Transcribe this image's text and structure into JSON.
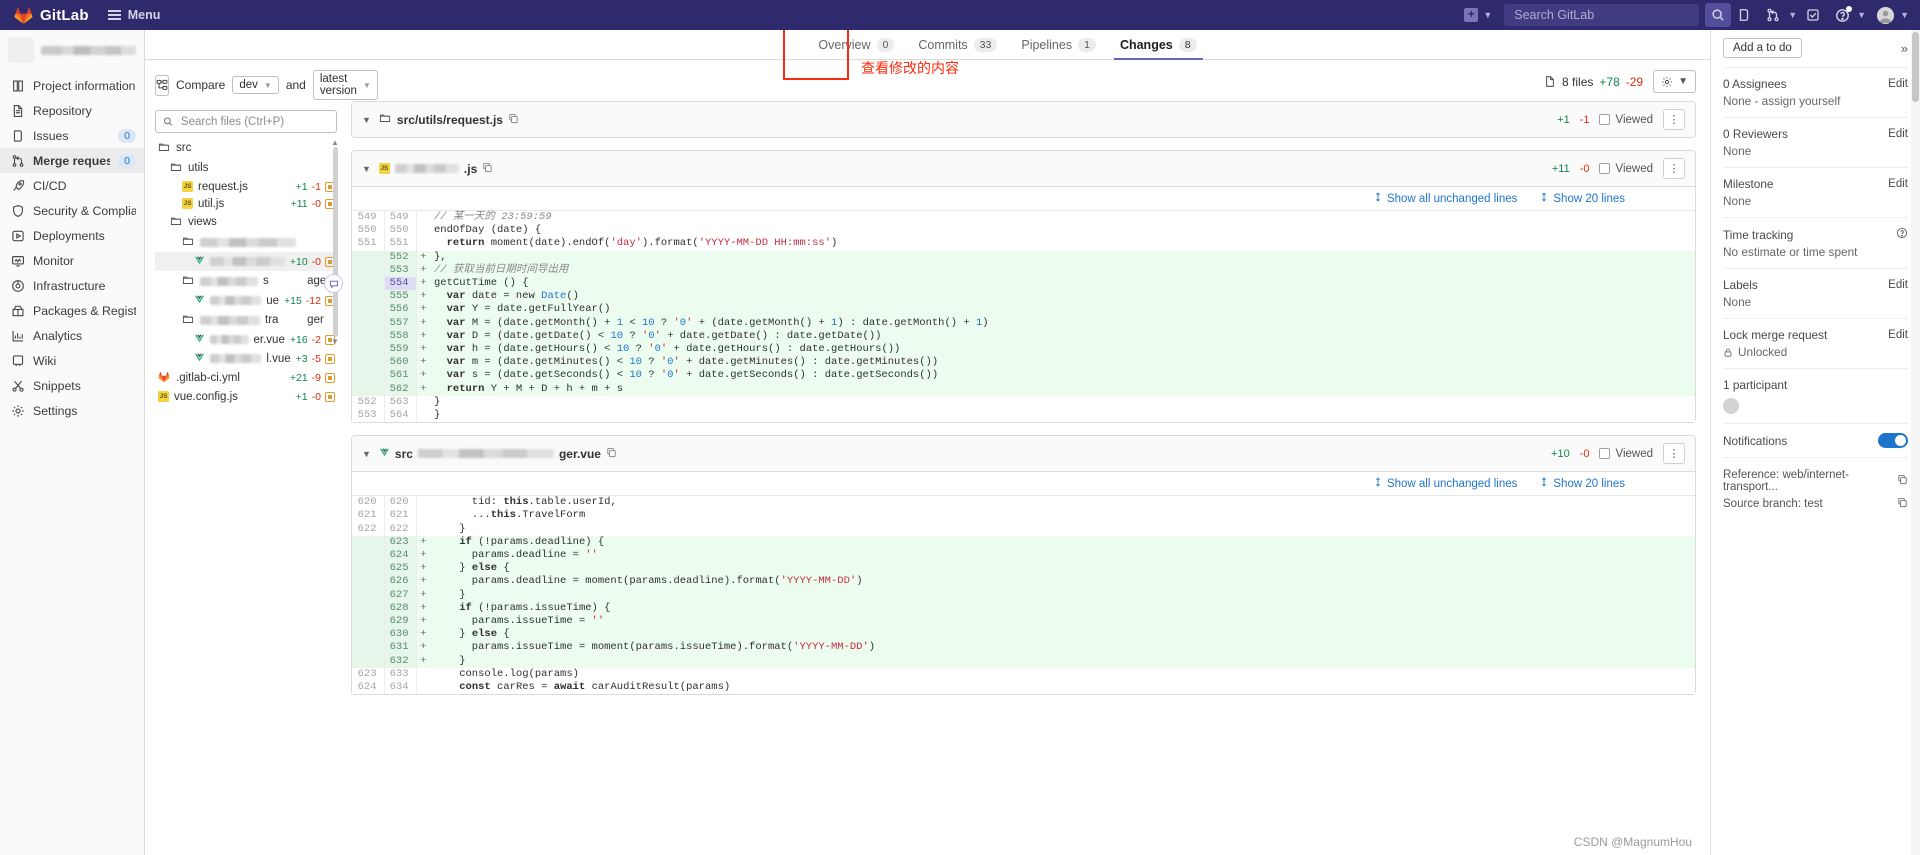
{
  "topnav": {
    "brand": "GitLab",
    "menu_label": "Menu",
    "search_placeholder": "Search GitLab",
    "search_value": "",
    "icons": {
      "plus": "plus-square-icon",
      "caret": "chevron-down-icon",
      "search": "search-icon",
      "issues": "issues-icon",
      "merge_requests": "merge-request-icon",
      "todos": "todo-checkbox-icon",
      "help": "help-circle-icon",
      "avatar": "user-avatar"
    }
  },
  "sidebar": {
    "project_name": "",
    "items": [
      {
        "label": "Project information",
        "icon": "book-icon",
        "badge": ""
      },
      {
        "label": "Repository",
        "icon": "file-icon",
        "badge": ""
      },
      {
        "label": "Issues",
        "icon": "issues-icon",
        "badge": "0"
      },
      {
        "label": "Merge requests",
        "icon": "merge-request-icon",
        "badge": "0"
      },
      {
        "label": "CI/CD",
        "icon": "rocket-icon",
        "badge": ""
      },
      {
        "label": "Security & Compliance",
        "icon": "shield-icon",
        "badge": ""
      },
      {
        "label": "Deployments",
        "icon": "deploy-icon",
        "badge": ""
      },
      {
        "label": "Monitor",
        "icon": "monitor-icon",
        "badge": ""
      },
      {
        "label": "Infrastructure",
        "icon": "infrastructure-icon",
        "badge": ""
      },
      {
        "label": "Packages & Registries",
        "icon": "package-icon",
        "badge": ""
      },
      {
        "label": "Analytics",
        "icon": "chart-icon",
        "badge": ""
      },
      {
        "label": "Wiki",
        "icon": "wiki-icon",
        "badge": ""
      },
      {
        "label": "Snippets",
        "icon": "scissors-icon",
        "badge": ""
      },
      {
        "label": "Settings",
        "icon": "gear-icon",
        "badge": ""
      }
    ],
    "active_index": 3
  },
  "tabs": [
    {
      "label": "Overview",
      "count": "0",
      "active": false
    },
    {
      "label": "Commits",
      "count": "33",
      "active": false
    },
    {
      "label": "Pipelines",
      "count": "1",
      "active": false
    },
    {
      "label": "Changes",
      "count": "8",
      "active": true
    }
  ],
  "annotation": {
    "text": "查看修改的内容",
    "color": "#fb2b0d"
  },
  "compare": {
    "label": "Compare",
    "source": "dev",
    "target": "latest version",
    "tree_icon": "file-tree-icon"
  },
  "file_search": {
    "placeholder": "Search files (Ctrl+P)",
    "value": ""
  },
  "file_tree": [
    {
      "depth": 0,
      "type": "folder",
      "name": "src",
      "blurred": false,
      "stats": null
    },
    {
      "depth": 1,
      "type": "folder",
      "name": "utils",
      "blurred": false,
      "stats": null
    },
    {
      "depth": 2,
      "type": "js",
      "name": "request.js",
      "blurred": false,
      "stats": {
        "add": "+1",
        "del": "-1"
      }
    },
    {
      "depth": 2,
      "type": "js",
      "name": "util.js",
      "blurred": false,
      "stats": {
        "add": "+11",
        "del": "-0"
      }
    },
    {
      "depth": 1,
      "type": "folder",
      "name": "views",
      "blurred": false,
      "stats": null
    },
    {
      "depth": 2,
      "type": "folder",
      "name": "",
      "blurred": true,
      "blur_width": 96,
      "stats": null
    },
    {
      "depth": 3,
      "type": "vue",
      "name": "",
      "blurred": true,
      "blur_width": 92,
      "selected": true,
      "stats": {
        "add": "+10",
        "del": "-0"
      }
    },
    {
      "depth": 2,
      "type": "folder",
      "name": "s            age",
      "blurred": "partial",
      "blur_width": 58,
      "stats": null
    },
    {
      "depth": 3,
      "type": "vue",
      "name": "ue",
      "blurred": "partial",
      "blur_width": 98,
      "stats": {
        "add": "+15",
        "del": "-12"
      }
    },
    {
      "depth": 2,
      "type": "folder",
      "name": "tra         ger",
      "blurred": "partial",
      "blur_width": 60,
      "stats": null
    },
    {
      "depth": 3,
      "type": "vue",
      "name": "er.vue",
      "blurred": "partial",
      "blur_width": 86,
      "stats": {
        "add": "+16",
        "del": "-2"
      }
    },
    {
      "depth": 3,
      "type": "vue",
      "name": "l.vue",
      "blurred": "partial",
      "blur_width": 72,
      "stats": {
        "add": "+3",
        "del": "-5"
      }
    },
    {
      "depth": 0,
      "type": "gitlab",
      "name": ".gitlab-ci.yml",
      "blurred": false,
      "stats": {
        "add": "+21",
        "del": "-9"
      }
    },
    {
      "depth": 0,
      "type": "js",
      "name": "vue.config.js",
      "blurred": false,
      "stats": {
        "add": "+1",
        "del": "-0"
      }
    }
  ],
  "diff_summary": {
    "files_label": "8 files",
    "additions": "+78",
    "deletions": "-29",
    "gear_icon": "gear-icon"
  },
  "diff_files": [
    {
      "path": "src/utils/request.js",
      "blurred": false,
      "additions": "+1",
      "deletions": "-1",
      "viewed_label": "Viewed",
      "collapsed": true,
      "hunks": []
    },
    {
      "path": ".js",
      "blurred": true,
      "blur_width": 64,
      "additions": "+11",
      "deletions": "-0",
      "viewed_label": "Viewed",
      "collapsed": false,
      "expand_links": [
        {
          "label": "Show all unchanged lines",
          "icon": "expand-icon"
        },
        {
          "label": "Show 20 lines",
          "icon": "expand-icon"
        }
      ],
      "lines": [
        {
          "old": "549",
          "new": "549",
          "sign": "",
          "type": "ctx",
          "code": "// 某一天的 23:59:59",
          "style": "comment"
        },
        {
          "old": "550",
          "new": "550",
          "sign": "",
          "type": "ctx",
          "code": "endOfDay (date) {"
        },
        {
          "old": "551",
          "new": "551",
          "sign": "",
          "type": "ctx",
          "code": "  return moment(date).endOf('day').format('YYYY-MM-DD HH:mm:ss')"
        },
        {
          "old": "",
          "new": "552",
          "sign": "+",
          "type": "add",
          "code": "},"
        },
        {
          "old": "",
          "new": "553",
          "sign": "+",
          "type": "add",
          "code": "// 获取当前日期时间导出用",
          "style": "comment"
        },
        {
          "old": "",
          "new": "554",
          "sign": "+",
          "type": "add",
          "code": "getCutTime () {",
          "highlight": true
        },
        {
          "old": "",
          "new": "555",
          "sign": "+",
          "type": "add",
          "code": "  var date = new Date()"
        },
        {
          "old": "",
          "new": "556",
          "sign": "+",
          "type": "add",
          "code": "  var Y = date.getFullYear()"
        },
        {
          "old": "",
          "new": "557",
          "sign": "+",
          "type": "add",
          "code": "  var M = (date.getMonth() + 1 < 10 ? '0' + (date.getMonth() + 1) : date.getMonth() + 1)"
        },
        {
          "old": "",
          "new": "558",
          "sign": "+",
          "type": "add",
          "code": "  var D = (date.getDate() < 10 ? '0' + date.getDate() : date.getDate())"
        },
        {
          "old": "",
          "new": "559",
          "sign": "+",
          "type": "add",
          "code": "  var h = (date.getHours() < 10 ? '0' + date.getHours() : date.getHours())"
        },
        {
          "old": "",
          "new": "560",
          "sign": "+",
          "type": "add",
          "code": "  var m = (date.getMinutes() < 10 ? '0' + date.getMinutes() : date.getMinutes())"
        },
        {
          "old": "",
          "new": "561",
          "sign": "+",
          "type": "add",
          "code": "  var s = (date.getSeconds() < 10 ? '0' + date.getSeconds() : date.getSeconds())"
        },
        {
          "old": "",
          "new": "562",
          "sign": "+",
          "type": "add",
          "code": "  return Y + M + D + h + m + s"
        },
        {
          "old": "552",
          "new": "563",
          "sign": "",
          "type": "ctx",
          "code": "}"
        },
        {
          "old": "553",
          "new": "564",
          "sign": "",
          "type": "ctx",
          "code": "}"
        }
      ]
    },
    {
      "path_prefix": "src",
      "path_suffix": "ger.vue",
      "blurred": true,
      "blur_width": 136,
      "additions": "+10",
      "deletions": "-0",
      "viewed_label": "Viewed",
      "collapsed": false,
      "expand_links": [
        {
          "label": "Show all unchanged lines",
          "icon": "expand-icon"
        },
        {
          "label": "Show 20 lines",
          "icon": "expand-icon"
        }
      ],
      "lines": [
        {
          "old": "620",
          "new": "620",
          "sign": "",
          "type": "ctx",
          "code": "      tid: this.table.userId,"
        },
        {
          "old": "621",
          "new": "621",
          "sign": "",
          "type": "ctx",
          "code": "      ...this.TravelForm"
        },
        {
          "old": "622",
          "new": "622",
          "sign": "",
          "type": "ctx",
          "code": "    }"
        },
        {
          "old": "",
          "new": "623",
          "sign": "+",
          "type": "add",
          "code": "    if (!params.deadline) {"
        },
        {
          "old": "",
          "new": "624",
          "sign": "+",
          "type": "add",
          "code": "      params.deadline = ''"
        },
        {
          "old": "",
          "new": "625",
          "sign": "+",
          "type": "add",
          "code": "    } else {"
        },
        {
          "old": "",
          "new": "626",
          "sign": "+",
          "type": "add",
          "code": "      params.deadline = moment(params.deadline).format('YYYY-MM-DD')"
        },
        {
          "old": "",
          "new": "627",
          "sign": "+",
          "type": "add",
          "code": "    }"
        },
        {
          "old": "",
          "new": "628",
          "sign": "+",
          "type": "add",
          "code": "    if (!params.issueTime) {"
        },
        {
          "old": "",
          "new": "629",
          "sign": "+",
          "type": "add",
          "code": "      params.issueTime = ''"
        },
        {
          "old": "",
          "new": "630",
          "sign": "+",
          "type": "add",
          "code": "    } else {"
        },
        {
          "old": "",
          "new": "631",
          "sign": "+",
          "type": "add",
          "code": "      params.issueTime = moment(params.issueTime).format('YYYY-MM-DD')"
        },
        {
          "old": "",
          "new": "632",
          "sign": "+",
          "type": "add",
          "code": "    }"
        },
        {
          "old": "623",
          "new": "633",
          "sign": "",
          "type": "ctx",
          "code": "    console.log(params)"
        },
        {
          "old": "624",
          "new": "634",
          "sign": "",
          "type": "ctx",
          "code": "    const carRes = await carAuditResult(params)"
        }
      ]
    }
  ],
  "right_sidebar": {
    "todo_label": "Add a to do",
    "collapse_icon": "chevron-double-right-icon",
    "blocks": [
      {
        "title": "0 Assignees",
        "action": "Edit",
        "value": "None - assign yourself"
      },
      {
        "title": "0 Reviewers",
        "action": "Edit",
        "value": "None"
      },
      {
        "title": "Milestone",
        "action": "Edit",
        "value": "None"
      },
      {
        "title": "Time tracking",
        "action": "?",
        "value": "No estimate or time spent"
      },
      {
        "title": "Labels",
        "action": "Edit",
        "value": "None"
      }
    ],
    "lock": {
      "title": "Lock merge request",
      "action": "Edit",
      "value": "Unlocked",
      "icon": "lock-icon"
    },
    "participants": {
      "title": "1 participant"
    },
    "notifications": {
      "title": "Notifications",
      "enabled": true
    },
    "reference": {
      "label": "Reference: web/internet-transport...",
      "copy_icon": "copy-icon"
    },
    "source_branch": {
      "label": "Source branch: test",
      "copy_icon": "copy-icon"
    }
  },
  "watermark": "CSDN @MagnumHou"
}
